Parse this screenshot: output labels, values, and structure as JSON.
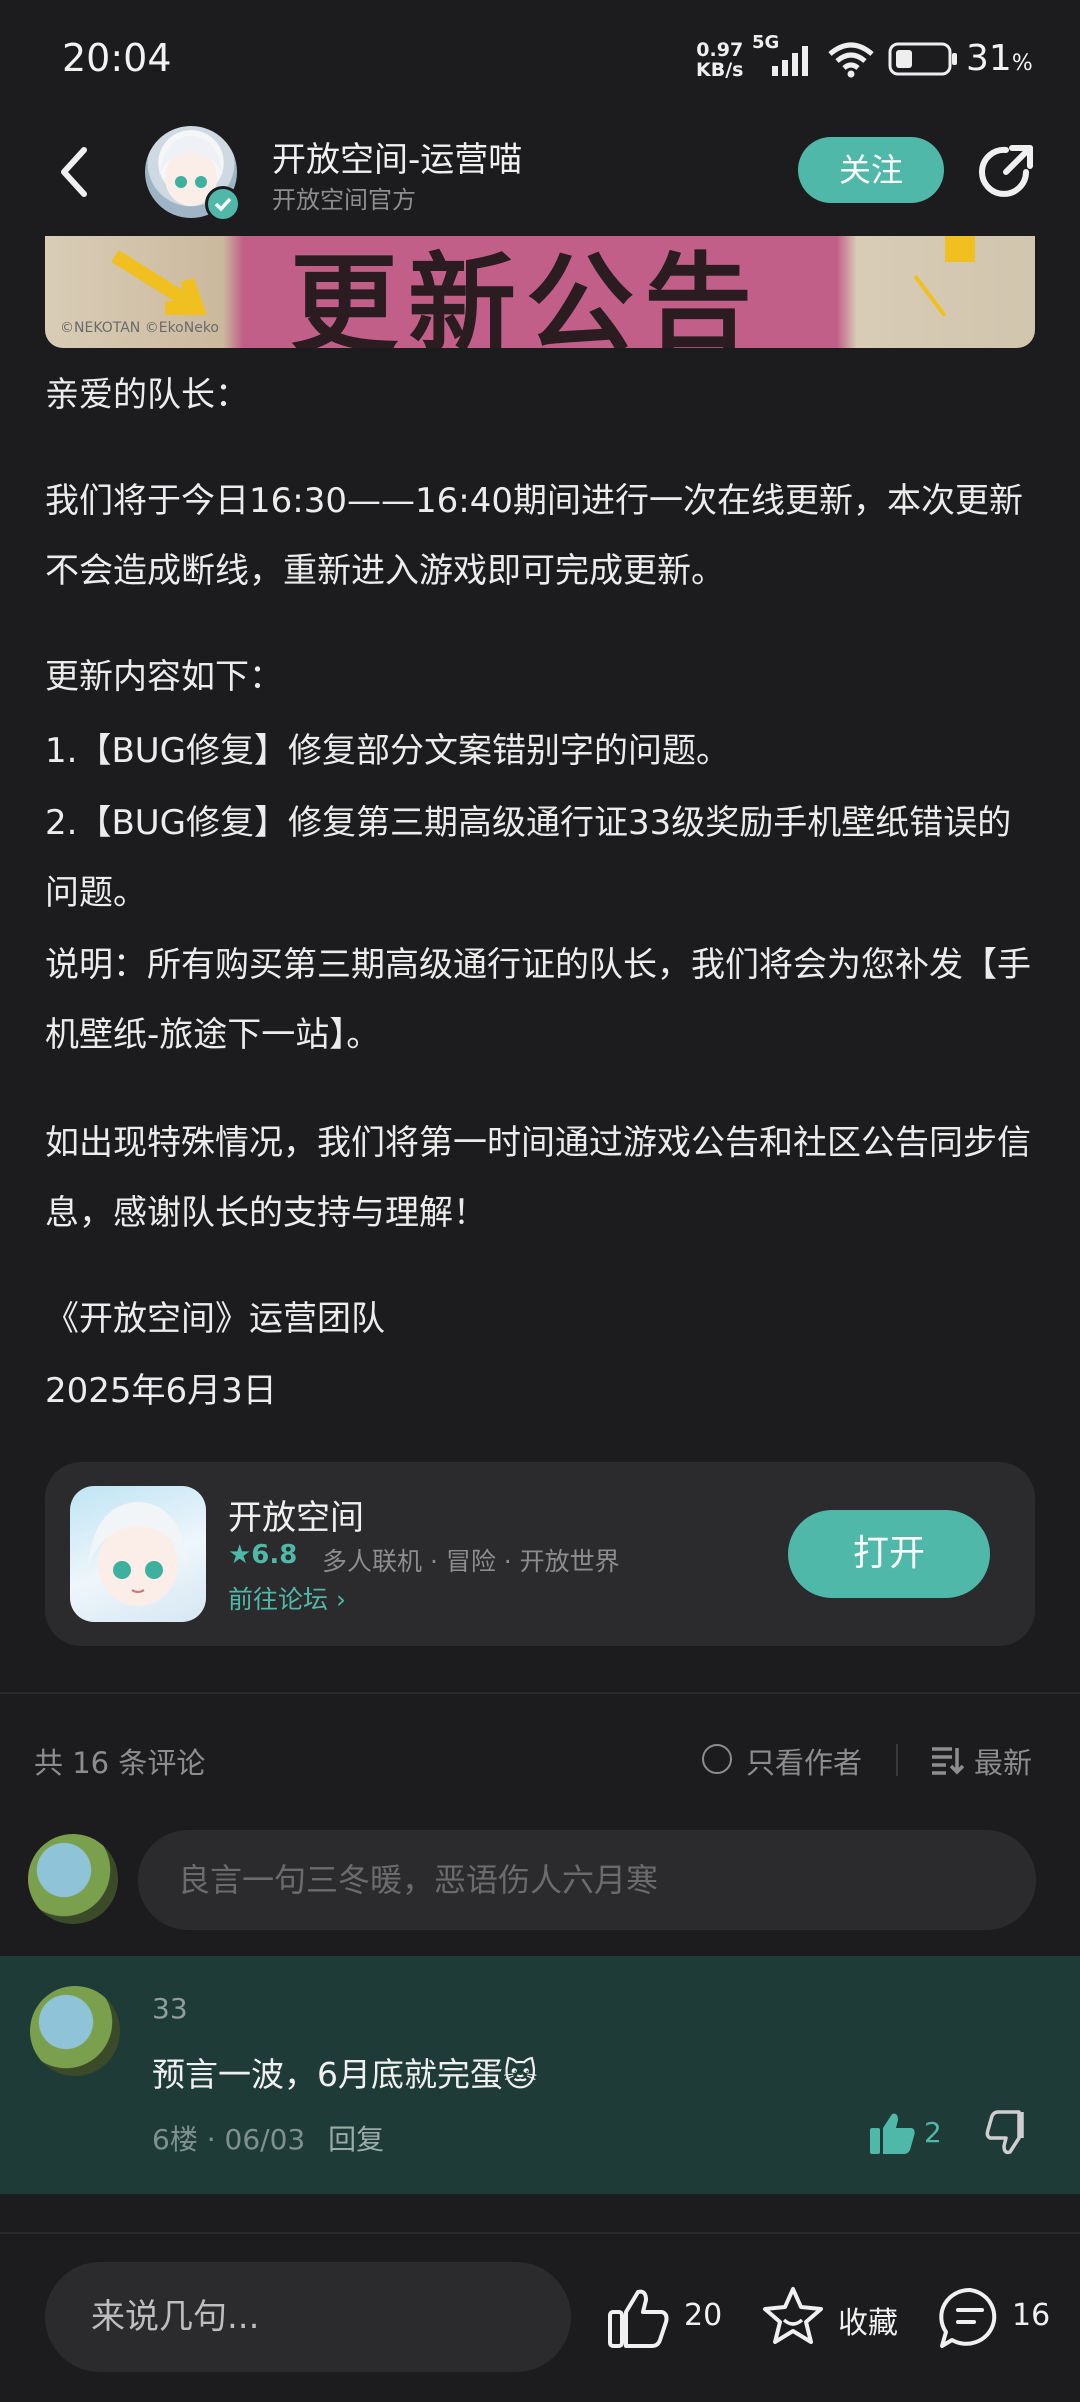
{
  "status": {
    "time": "20:04",
    "net_speed_value": "0.97",
    "net_speed_unit": "KB/s",
    "network": "5G",
    "battery": "31",
    "battery_unit": "%"
  },
  "header": {
    "author_name": "开放空间-运营喵",
    "author_subtitle": "开放空间官方",
    "follow_label": "关注"
  },
  "banner": {
    "title": "更新公告",
    "credit": "©NEKOTAN ©EkoNeko"
  },
  "article": {
    "greeting": "亲爱的队长：",
    "p1": "我们将于今日16:30——16:40期间进行一次在线更新，本次更新不会造成断线，重新进入游戏即可完成更新。",
    "p2_title": "更新内容如下：",
    "p2_item1": "1.【BUG修复】修复部分文案错别字的问题。",
    "p2_item2": "2.【BUG修复】修复第三期高级通行证33级奖励手机壁纸错误的问题。",
    "p2_note": "说明：所有购买第三期高级通行证的队长，我们将会为您补发【手机壁纸-旅途下一站】。",
    "p3": "如出现特殊情况，我们将第一时间通过游戏公告和社区公告同步信息，感谢队长的支持与理解！",
    "sign_team": "《开放空间》运营团队",
    "sign_date": "2025年6月3日"
  },
  "app_card": {
    "name": "开放空间",
    "rating": "★6.8",
    "tags": "多人联机 · 冒险 · 开放世界",
    "forum_link": "前往论坛 ›",
    "open_label": "打开"
  },
  "comments": {
    "count_label": "共 16 条评论",
    "only_author": "只看作者",
    "sort_label": "最新",
    "input_placeholder": "良言一句三冬暖，恶语伤人六月寒",
    "items": [
      {
        "user": "33",
        "text": "预言一波，6月底就完蛋🐱",
        "meta": "6楼 · 06/03",
        "reply": "回复",
        "likes": "2"
      }
    ]
  },
  "bottom_bar": {
    "reply_placeholder": "来说几句...",
    "like_count": "20",
    "favorite_label": "收藏",
    "comment_count": "16"
  },
  "colors": {
    "accent": "#4fb8a8",
    "background": "#1c1c1e",
    "highlight_comment": "#1f3b38"
  }
}
